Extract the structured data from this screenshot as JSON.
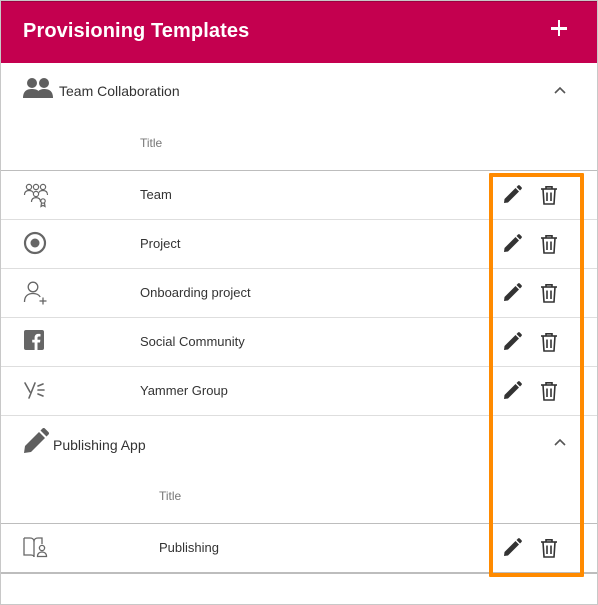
{
  "header": {
    "title": "Provisioning Templates",
    "add_icon": "plus-icon",
    "background": "#c4004f"
  },
  "groups": [
    {
      "title": "Team Collaboration",
      "icon": "people-icon",
      "column_title": "Title",
      "items": [
        {
          "title": "Team",
          "icon": "team-icon"
        },
        {
          "title": "Project",
          "icon": "target-icon"
        },
        {
          "title": "Onboarding project",
          "icon": "person-add-icon"
        },
        {
          "title": "Social Community",
          "icon": "facebook-icon"
        },
        {
          "title": "Yammer Group",
          "icon": "yammer-icon"
        }
      ]
    },
    {
      "title": "Publishing App",
      "icon": "pencil-icon",
      "column_title": "Title",
      "items": [
        {
          "title": "Publishing",
          "icon": "book-reader-icon"
        }
      ]
    }
  ],
  "actions": {
    "edit_icon": "pencil-icon",
    "delete_icon": "trash-icon"
  },
  "highlight_color": "#ff8a00"
}
